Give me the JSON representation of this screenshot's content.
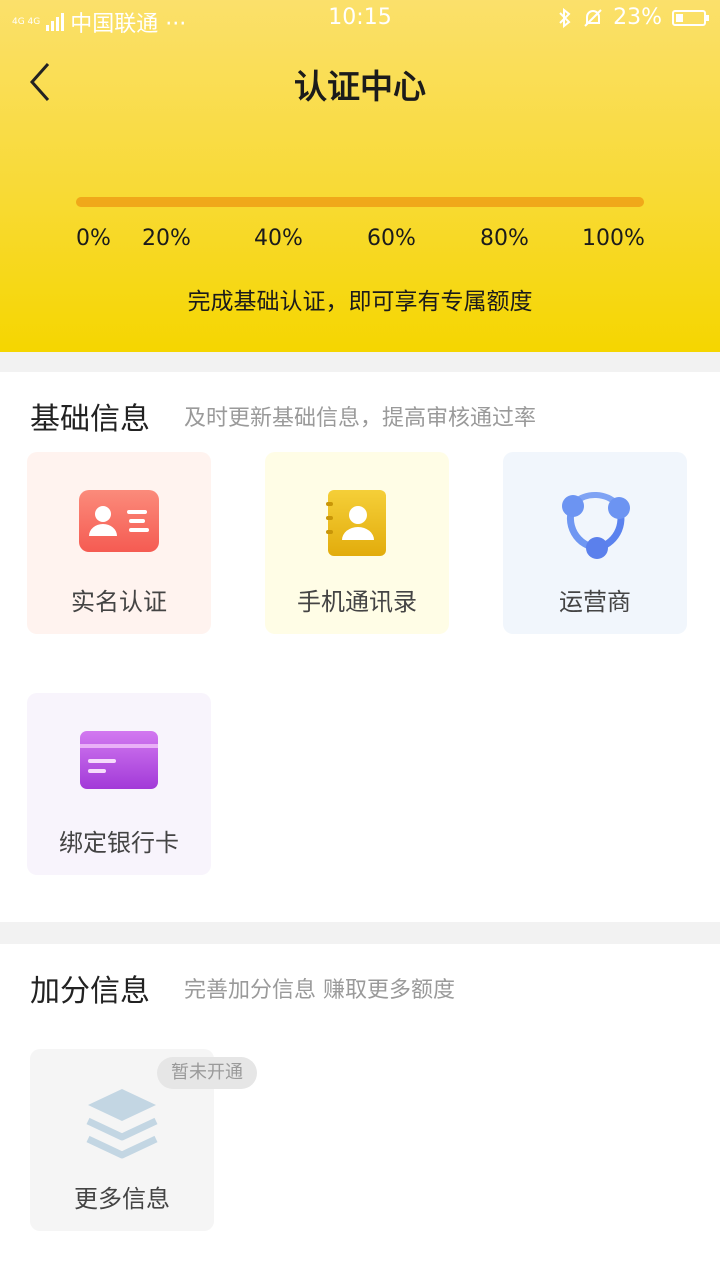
{
  "status": {
    "network": "4G 4G",
    "carrier": "中国联通 ···",
    "time": "10:15",
    "battery": "23%"
  },
  "header": {
    "title": "认证中心",
    "progress_percent": 100,
    "ticks": [
      "0%",
      "20%",
      "40%",
      "60%",
      "80%",
      "100%"
    ],
    "note": "完成基础认证，即可享有专属额度"
  },
  "basic": {
    "title": "基础信息",
    "subtitle": "及时更新基础信息，提高审核通过率",
    "items": [
      {
        "label": "实名认证",
        "icon": "id-card-icon",
        "bg": "#fff3ef",
        "color": "#f8675d"
      },
      {
        "label": "手机通讯录",
        "icon": "contacts-book-icon",
        "bg": "#fffde6",
        "color": "#e8bd17"
      },
      {
        "label": "运营商",
        "icon": "carrier-network-icon",
        "bg": "#f1f6fc",
        "color": "#5e8cf0"
      },
      {
        "label": "绑定银行卡",
        "icon": "bank-card-icon",
        "bg": "#f8f4fc",
        "color": "#b84de0"
      }
    ]
  },
  "bonus": {
    "title": "加分信息",
    "subtitle": "完善加分信息 赚取更多额度",
    "items": [
      {
        "label": "更多信息",
        "icon": "layers-icon",
        "badge": "暂未开通",
        "bg": "#f5f5f5"
      }
    ]
  }
}
